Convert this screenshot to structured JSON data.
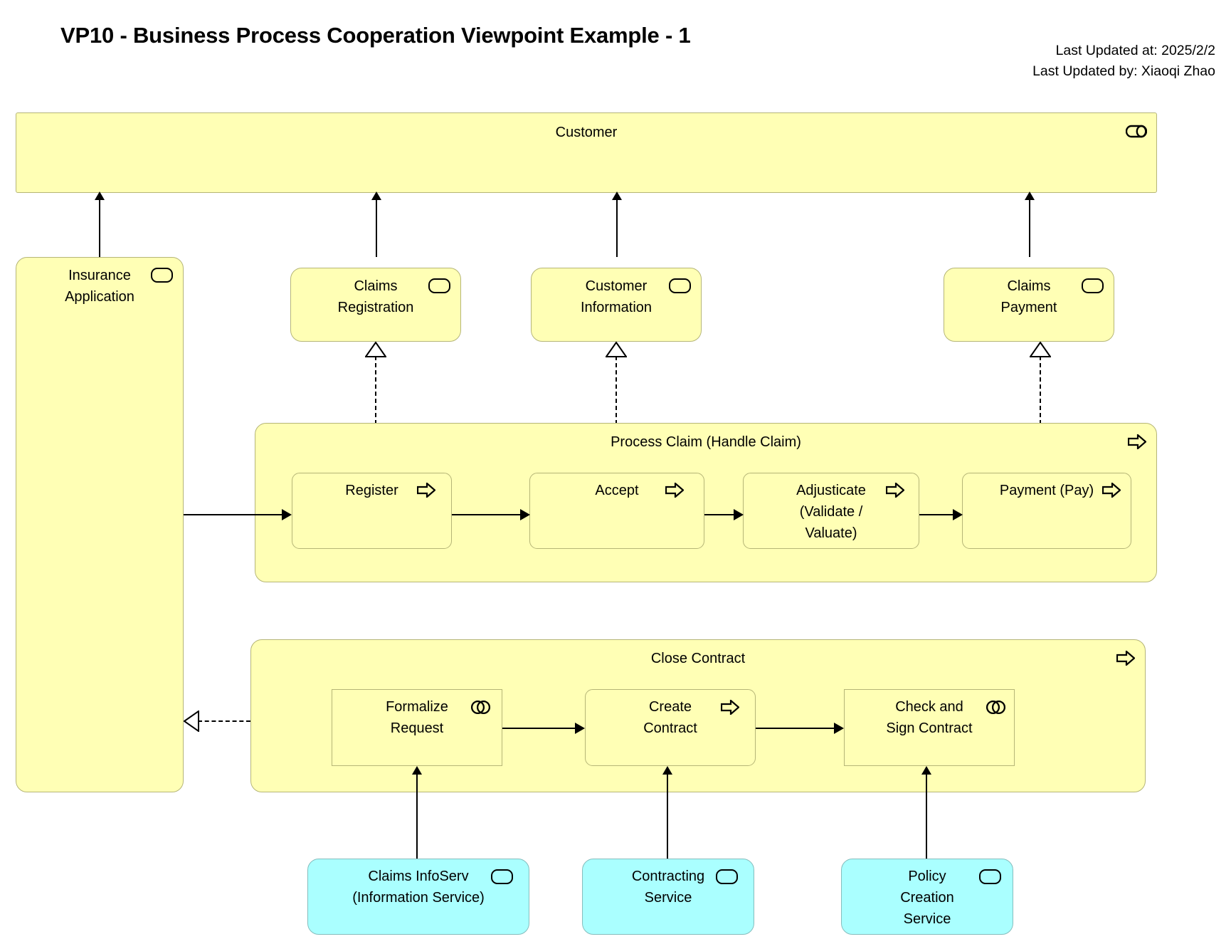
{
  "header": {
    "title": "VP10 - Business Process Cooperation Viewpoint Example - 1",
    "updated_at": "Last Updated at: 2025/2/2",
    "updated_by": "Last Updated by: Xiaoqi Zhao"
  },
  "colors": {
    "business_fill": "#FFFFB5",
    "business_border": "#B5B577",
    "application_fill": "#AAFFFF",
    "application_border": "#85BDBD",
    "line": "#000000",
    "background": "#FFFFFF"
  },
  "actors": {
    "customer": {
      "label": "Customer",
      "icon": "business-role-icon"
    }
  },
  "services": {
    "insurance_application": {
      "label": "Insurance\nApplication",
      "icon": "business-service-icon"
    },
    "claims_registration": {
      "label": "Claims\nRegistration",
      "icon": "business-service-icon"
    },
    "customer_information": {
      "label": "Customer\nInformation",
      "icon": "business-service-icon"
    },
    "claims_payment": {
      "label": "Claims\nPayment",
      "icon": "business-service-icon"
    }
  },
  "process_claim": {
    "title": "Process Claim (Handle Claim)",
    "icon": "business-process-icon",
    "steps": [
      {
        "label": "Register",
        "icon": "business-process-icon",
        "shape": "rounded"
      },
      {
        "label": "Accept",
        "icon": "business-process-icon",
        "shape": "rounded"
      },
      {
        "label": "Adjusticate\n(Validate /\nValuate)",
        "icon": "business-process-icon",
        "shape": "rounded"
      },
      {
        "label": "Payment (Pay)",
        "icon": "business-process-icon",
        "shape": "rounded"
      }
    ]
  },
  "close_contract": {
    "title": "Close Contract",
    "icon": "business-process-icon",
    "steps": [
      {
        "label": "Formalize\nRequest",
        "icon": "business-interaction-icon",
        "shape": "sharp"
      },
      {
        "label": "Create\nContract",
        "icon": "business-process-icon",
        "shape": "rounded"
      },
      {
        "label": "Check and\nSign Contract",
        "icon": "business-interaction-icon",
        "shape": "sharp"
      }
    ]
  },
  "application_services": [
    {
      "label": "Claims InfoServ\n(Information Service)",
      "icon": "application-service-icon"
    },
    {
      "label": "Contracting\nService",
      "icon": "application-service-icon"
    },
    {
      "label": "Policy\nCreation\nService",
      "icon": "application-service-icon"
    }
  ],
  "relationships": [
    {
      "type": "serving",
      "from": "Insurance Application",
      "to": "Customer"
    },
    {
      "type": "serving",
      "from": "Claims Registration",
      "to": "Customer"
    },
    {
      "type": "serving",
      "from": "Customer Information",
      "to": "Customer"
    },
    {
      "type": "serving",
      "from": "Claims Payment",
      "to": "Customer"
    },
    {
      "type": "realization",
      "from": "Register",
      "to": "Claims Registration"
    },
    {
      "type": "realization",
      "from": "Accept",
      "to": "Customer Information"
    },
    {
      "type": "realization",
      "from": "Payment (Pay)",
      "to": "Claims Payment"
    },
    {
      "type": "realization",
      "from": "Close Contract",
      "to": "Insurance Application"
    },
    {
      "type": "trigger",
      "from": "Insurance Application",
      "to": "Register"
    },
    {
      "type": "trigger",
      "from": "Register",
      "to": "Accept"
    },
    {
      "type": "trigger",
      "from": "Accept",
      "to": "Adjusticate (Validate / Valuate)"
    },
    {
      "type": "trigger",
      "from": "Adjusticate (Validate / Valuate)",
      "to": "Payment (Pay)"
    },
    {
      "type": "trigger",
      "from": "Formalize Request",
      "to": "Create Contract"
    },
    {
      "type": "trigger",
      "from": "Create Contract",
      "to": "Check and Sign Contract"
    },
    {
      "type": "serving",
      "from": "Claims InfoServ (Information Service)",
      "to": "Formalize Request"
    },
    {
      "type": "serving",
      "from": "Contracting Service",
      "to": "Create Contract"
    },
    {
      "type": "serving",
      "from": "Policy Creation Service",
      "to": "Check and Sign Contract"
    }
  ]
}
